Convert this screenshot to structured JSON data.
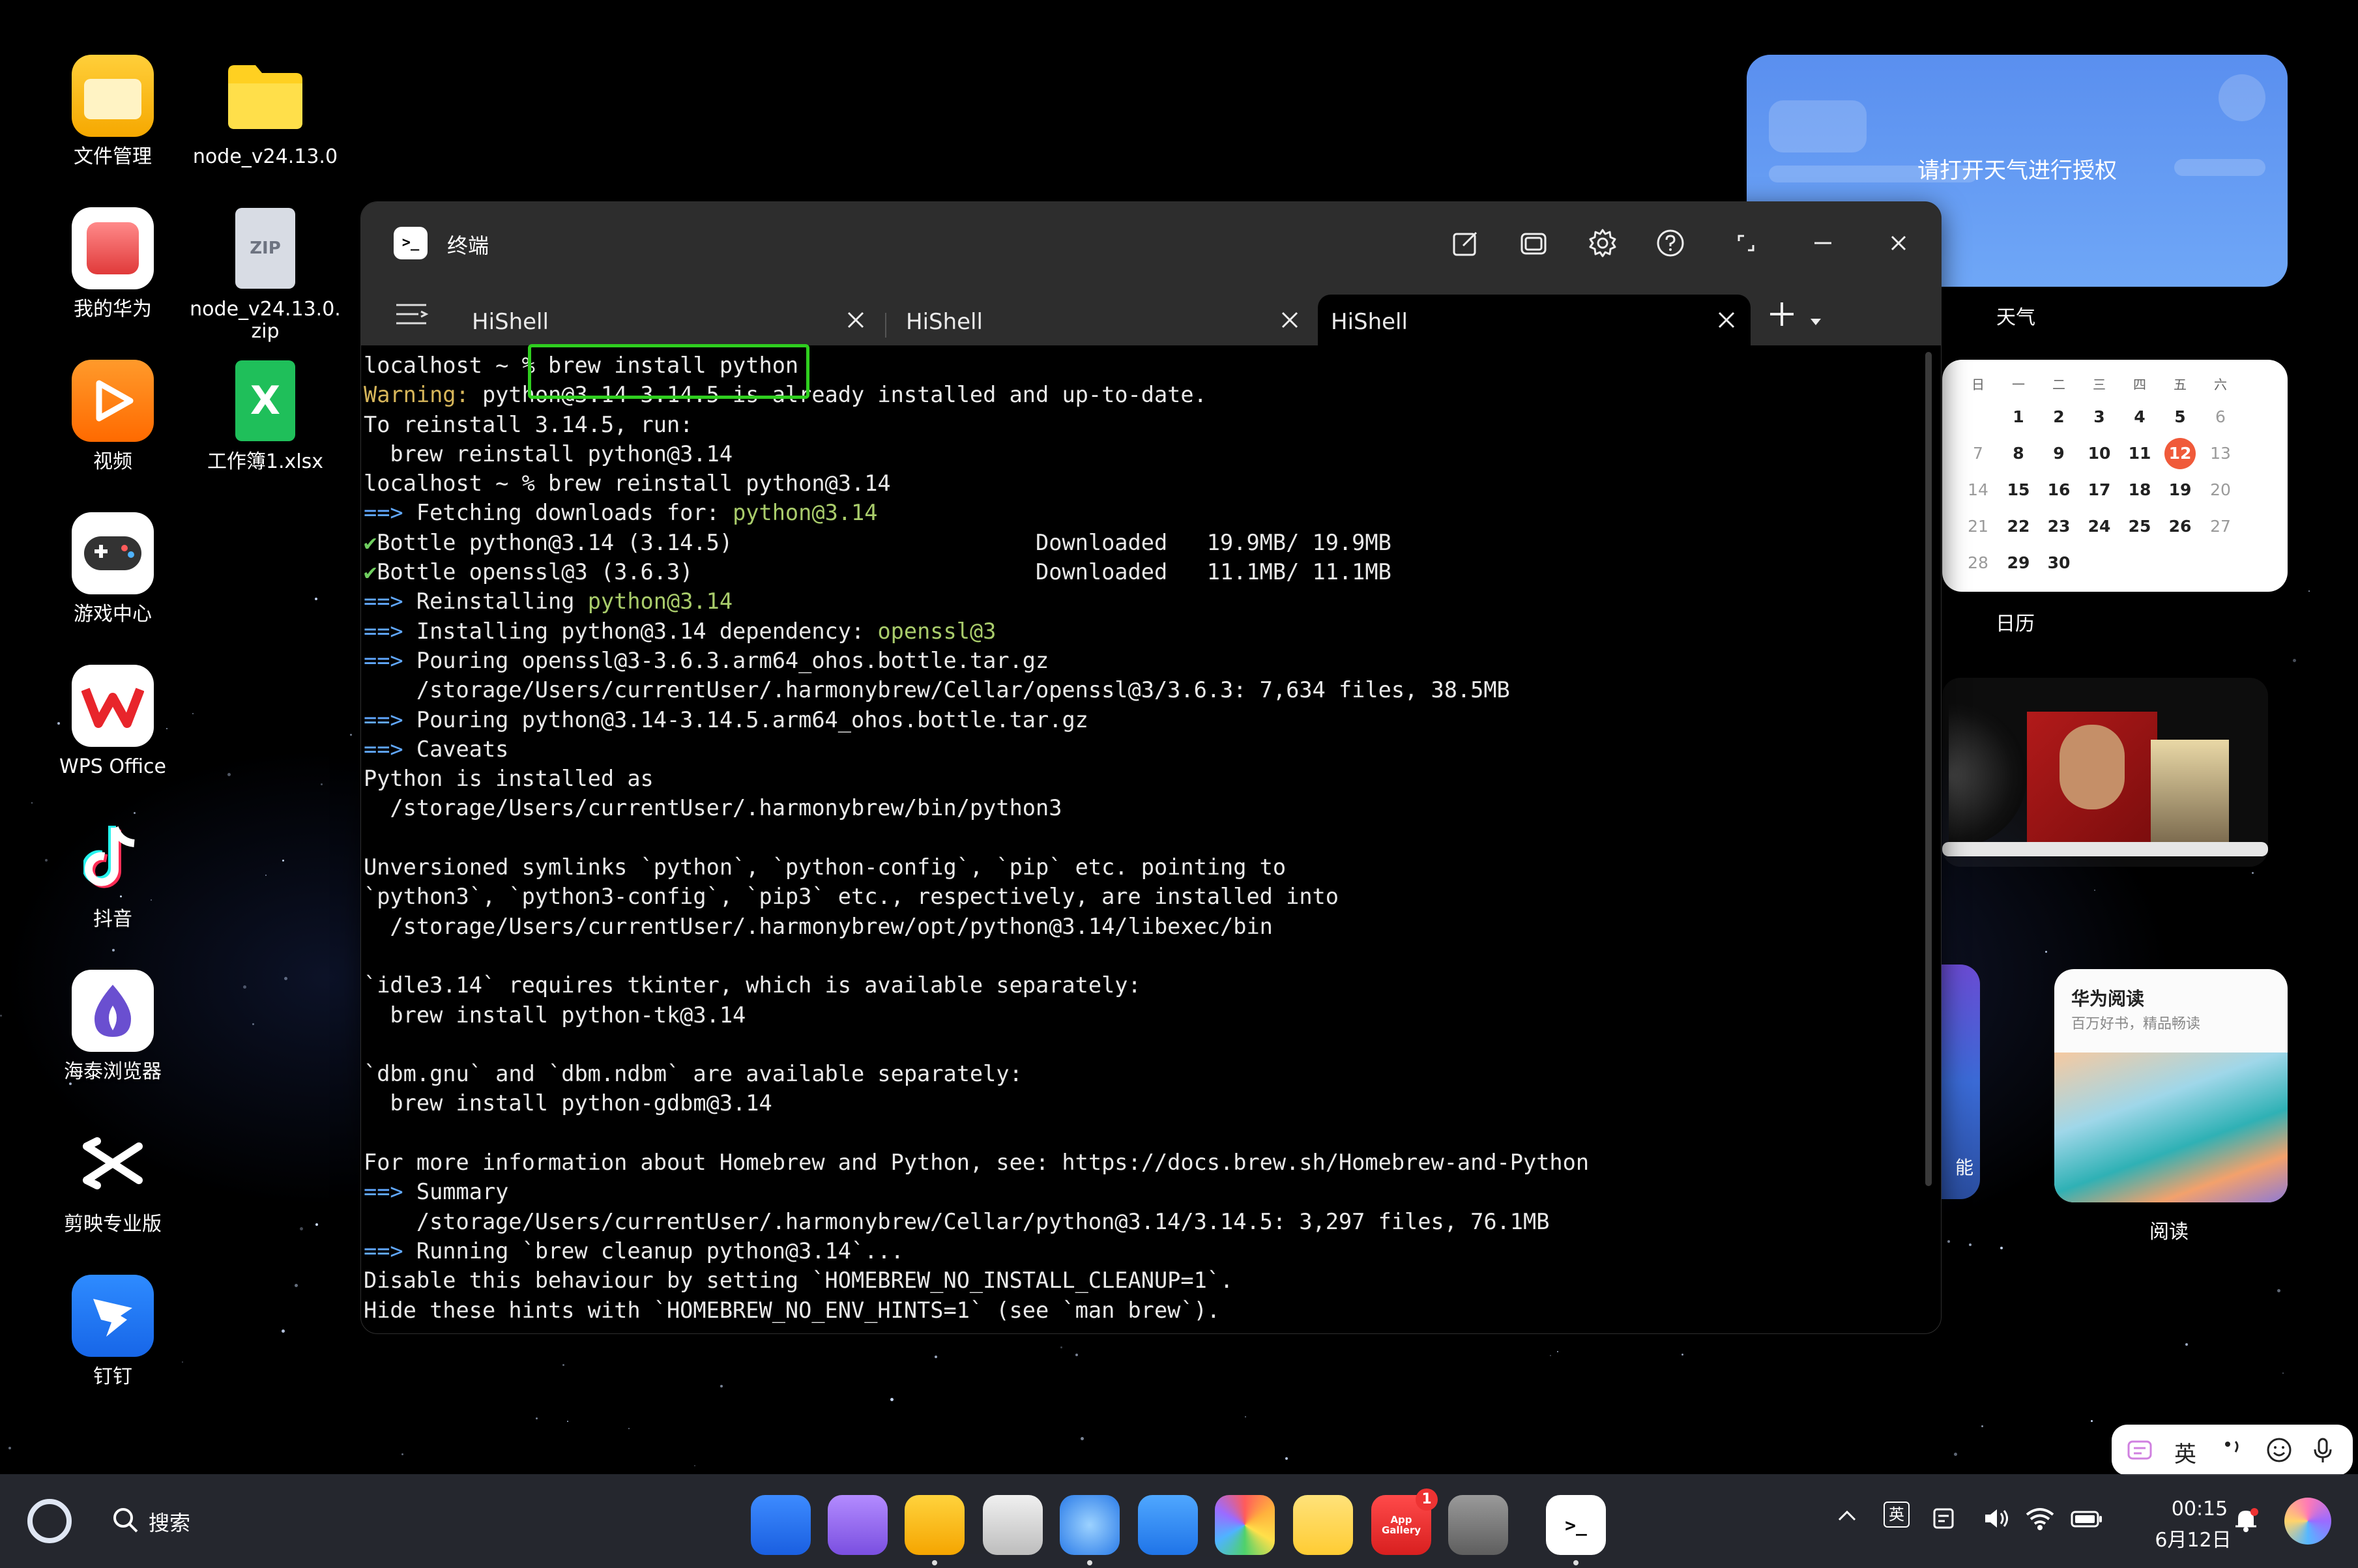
{
  "desktop": {
    "icons": [
      {
        "label": "文件管理",
        "icon": "file-manager-icon"
      },
      {
        "label": "node_v24.13.0",
        "icon": "folder-icon"
      },
      {
        "label": "我的华为",
        "icon": "my-huawei-icon"
      },
      {
        "label": "node_v24.13.0.\nzip",
        "icon": "zip-file-icon"
      },
      {
        "label": "视频",
        "icon": "video-icon"
      },
      {
        "label": "工作簿1.xlsx",
        "icon": "spreadsheet-icon"
      },
      {
        "label": "游戏中心",
        "icon": "game-center-icon"
      },
      {
        "label": "WPS Office",
        "icon": "wps-icon"
      },
      {
        "label": "抖音",
        "icon": "douyin-icon"
      },
      {
        "label": "海泰浏览器",
        "icon": "browser-icon"
      },
      {
        "label": "剪映专业版",
        "icon": "capcut-icon"
      },
      {
        "label": "钉钉",
        "icon": "dingtalk-icon"
      }
    ],
    "zip_badge": "ZIP"
  },
  "widgets": {
    "weather": {
      "message": "请打开天气进行授权",
      "caption": "天气"
    },
    "calendar": {
      "caption": "日历",
      "weekdays": [
        "日",
        "一",
        "二",
        "三",
        "四",
        "五",
        "六"
      ],
      "weeks": [
        [
          "",
          "1",
          "2",
          "3",
          "4",
          "5",
          "6"
        ],
        [
          "7",
          "8",
          "9",
          "10",
          "11",
          "12",
          "13"
        ],
        [
          "14",
          "15",
          "16",
          "17",
          "18",
          "19",
          "20"
        ],
        [
          "21",
          "22",
          "23",
          "24",
          "25",
          "26",
          "27"
        ],
        [
          "28",
          "29",
          "30",
          "",
          "",
          "",
          ""
        ]
      ],
      "today": "12"
    },
    "reading": {
      "title": "华为阅读",
      "subtitle": "百万好书，精品畅读",
      "caption": "阅读"
    },
    "side_label": "能"
  },
  "terminal": {
    "app_title": "终端",
    "tabs": [
      {
        "label": "HiShell",
        "active": false
      },
      {
        "label": "HiShell",
        "active": false
      },
      {
        "label": "HiShell",
        "active": true
      }
    ],
    "lines": [
      [
        {
          "t": "localhost ~ % brew install python"
        }
      ],
      [
        {
          "t": "Warning:",
          "c": "warn"
        },
        {
          "t": " python@3.14 3.14.5 is already installed and up-to-date."
        }
      ],
      [
        {
          "t": "To reinstall 3.14.5, run:"
        }
      ],
      [
        {
          "t": "  brew reinstall python@3.14"
        }
      ],
      [
        {
          "t": "localhost ~ % brew reinstall python@3.14"
        }
      ],
      [
        {
          "t": "==>",
          "c": "arrow"
        },
        {
          "t": " Fetching downloads for: "
        },
        {
          "t": "python@3.14",
          "c": "green"
        }
      ],
      [
        {
          "t": "✔",
          "c": "check"
        },
        {
          "t": "Bottle python@3.14 (3.14.5)                       Downloaded   19.9MB/ 19.9MB"
        }
      ],
      [
        {
          "t": "✔",
          "c": "check"
        },
        {
          "t": "Bottle openssl@3 (3.6.3)                          Downloaded   11.1MB/ 11.1MB"
        }
      ],
      [
        {
          "t": "==>",
          "c": "arrow"
        },
        {
          "t": " Reinstalling "
        },
        {
          "t": "python@3.14",
          "c": "green"
        }
      ],
      [
        {
          "t": "==>",
          "c": "arrow"
        },
        {
          "t": " Installing python@3.14 dependency: "
        },
        {
          "t": "openssl@3",
          "c": "green"
        }
      ],
      [
        {
          "t": "==>",
          "c": "arrow"
        },
        {
          "t": " Pouring openssl@3-3.6.3.arm64_ohos.bottle.tar.gz"
        }
      ],
      [
        {
          "t": "    /storage/Users/currentUser/.harmonybrew/Cellar/openssl@3/3.6.3: 7,634 files, 38.5MB"
        }
      ],
      [
        {
          "t": "==>",
          "c": "arrow"
        },
        {
          "t": " Pouring python@3.14-3.14.5.arm64_ohos.bottle.tar.gz"
        }
      ],
      [
        {
          "t": "==>",
          "c": "arrow"
        },
        {
          "t": " Caveats"
        }
      ],
      [
        {
          "t": "Python is installed as"
        }
      ],
      [
        {
          "t": "  /storage/Users/currentUser/.harmonybrew/bin/python3"
        }
      ],
      [
        {
          "t": ""
        }
      ],
      [
        {
          "t": "Unversioned symlinks `python`, `python-config`, `pip` etc. pointing to"
        }
      ],
      [
        {
          "t": "`python3`, `python3-config`, `pip3` etc., respectively, are installed into"
        }
      ],
      [
        {
          "t": "  /storage/Users/currentUser/.harmonybrew/opt/python@3.14/libexec/bin"
        }
      ],
      [
        {
          "t": ""
        }
      ],
      [
        {
          "t": "`idle3.14` requires tkinter, which is available separately:"
        }
      ],
      [
        {
          "t": "  brew install python-tk@3.14"
        }
      ],
      [
        {
          "t": ""
        }
      ],
      [
        {
          "t": "`dbm.gnu` and `dbm.ndbm` are available separately:"
        }
      ],
      [
        {
          "t": "  brew install python-gdbm@3.14"
        }
      ],
      [
        {
          "t": ""
        }
      ],
      [
        {
          "t": "For more information about Homebrew and Python, see: https://docs.brew.sh/Homebrew-and-Python"
        }
      ],
      [
        {
          "t": "==>",
          "c": "arrow"
        },
        {
          "t": " Summary"
        }
      ],
      [
        {
          "t": "    /storage/Users/currentUser/.harmonybrew/Cellar/python@3.14/3.14.5: 3,297 files, 76.1MB"
        }
      ],
      [
        {
          "t": "==>",
          "c": "arrow"
        },
        {
          "t": " Running `brew cleanup python@3.14`..."
        }
      ],
      [
        {
          "t": "Disable this behaviour by setting `HOMEBREW_NO_INSTALL_CLEANUP=1`."
        }
      ],
      [
        {
          "t": "Hide these hints with `HOMEBREW_NO_ENV_HINTS=1` (see `man brew`)."
        }
      ]
    ]
  },
  "taskbar": {
    "search_label": "搜索",
    "dock": [
      {
        "icon": "app-grid-icon",
        "running": false
      },
      {
        "icon": "multitask-icon",
        "running": false
      },
      {
        "icon": "files-icon",
        "running": true
      },
      {
        "icon": "trash-icon",
        "running": false
      },
      {
        "icon": "browser-icon",
        "running": true
      },
      {
        "icon": "mail-icon",
        "running": false
      },
      {
        "icon": "photos-icon",
        "running": false
      },
      {
        "icon": "notes-icon",
        "running": false
      },
      {
        "icon": "app-gallery-icon",
        "running": false,
        "label": "App Gallery",
        "badge": "1"
      },
      {
        "icon": "settings-icon",
        "running": false
      },
      {
        "icon": "terminal-icon",
        "running": true
      }
    ],
    "ime_indicator": "英",
    "time": "00:15",
    "date": "6月12日"
  },
  "ime_bar": {
    "lang": "英"
  },
  "colors": {
    "terminal_bg": "#000000",
    "titlebar_bg": "#2d2d2d",
    "highlight_box": "#2fce1f",
    "warn": "#d7b65a",
    "arrow": "#61a8ff",
    "package": "#a9cc6b",
    "calendar_today": "#f05a3a"
  }
}
